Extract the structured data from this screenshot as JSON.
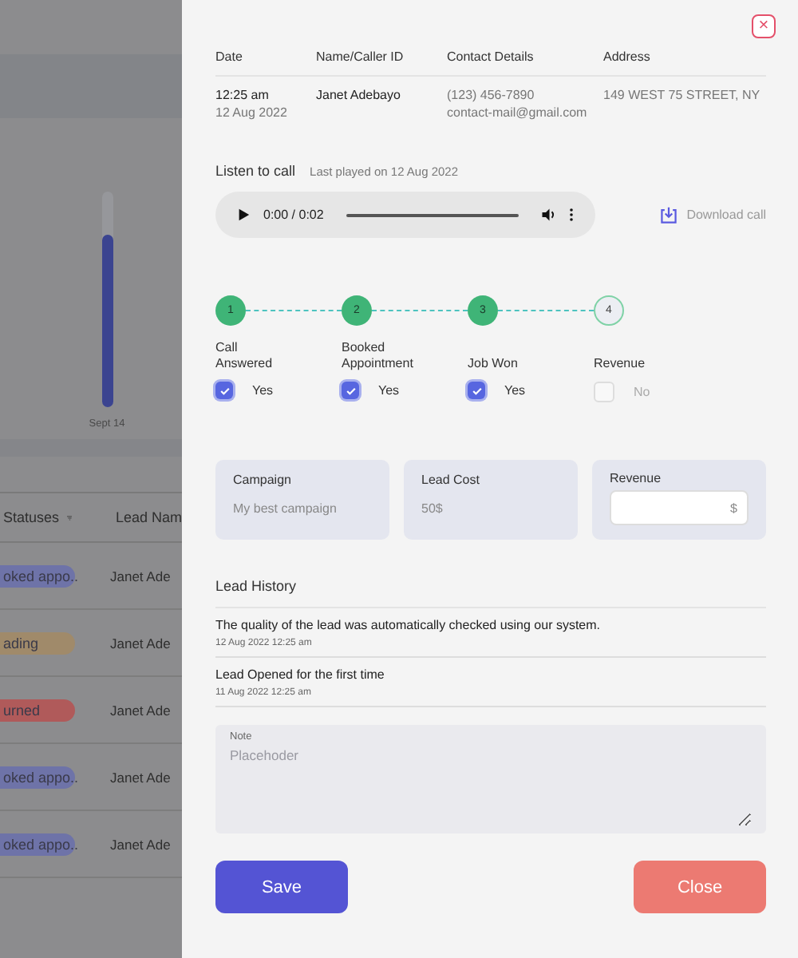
{
  "background": {
    "chart": {
      "level": 0.8,
      "label": "Sept 14"
    },
    "table": {
      "columns": [
        "Statuses",
        "Lead Nam"
      ],
      "rows": [
        {
          "status": "oked appo..",
          "color": "#6e73a8",
          "name": "Janet Ade"
        },
        {
          "status": "ading",
          "color": "#a08a6a",
          "name": "Janet Ade"
        },
        {
          "status": "urned",
          "color": "#b05a5a",
          "name": "Janet Ade"
        },
        {
          "status": "oked appo..",
          "color": "#6e73a8",
          "name": "Janet Ade"
        },
        {
          "status": "oked appo..",
          "color": "#6e73a8",
          "name": "Janet Ade"
        }
      ]
    }
  },
  "panel": {
    "close_icon": "×",
    "details": {
      "columns": [
        "Date",
        "Name/Caller ID",
        "Contact Details",
        "Address"
      ],
      "row": {
        "time": "12:25 am",
        "date": "12 Aug 2022",
        "name": "Janet Adebayo",
        "phone": "(123) 456-7890",
        "email": "contact-mail@gmail.com",
        "address": "149 WEST 75 STREET, NY"
      }
    },
    "listen": {
      "title": "Listen to call",
      "last_played": "Last played on 12 Aug 2022",
      "time": "0:00 / 0:02",
      "download": "Download call"
    },
    "steps": [
      {
        "number": "1",
        "label": "Call Answered",
        "done": true,
        "checked": true,
        "answer": "Yes"
      },
      {
        "number": "2",
        "label": "Booked Appointment",
        "done": true,
        "checked": true,
        "answer": "Yes"
      },
      {
        "number": "3",
        "label": "Job Won",
        "done": true,
        "checked": true,
        "answer": "Yes"
      },
      {
        "number": "4",
        "label": "Revenue",
        "done": false,
        "checked": false,
        "answer": "No"
      }
    ],
    "cards": [
      {
        "kind": "text",
        "label": "Campaign",
        "value": "My best campaign"
      },
      {
        "kind": "text",
        "label": "Lead Cost",
        "value": "50$"
      },
      {
        "kind": "input",
        "label": "Revenue",
        "suffix": "$"
      }
    ],
    "history": {
      "title": "Lead History",
      "items": [
        {
          "text": "The quality of the lead was automatically checked using our system.",
          "date": "12 Aug 2022 12:25 am"
        },
        {
          "text": "Lead Opened for the first time",
          "date": "11 Aug 2022 12:25 am"
        }
      ]
    },
    "note": {
      "label": "Note",
      "placeholder": "Placehoder"
    },
    "buttons": {
      "save": "Save",
      "close": "Close"
    }
  }
}
